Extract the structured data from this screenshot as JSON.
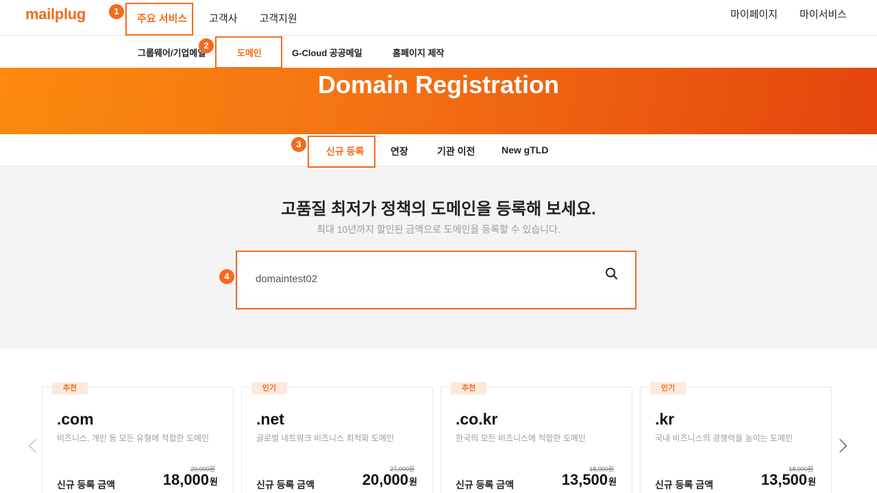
{
  "header": {
    "logo": "mailplug",
    "menu": [
      "주요 서비스",
      "고객사",
      "고객지원"
    ],
    "right_menu": [
      "마이페이지",
      "마이서비스"
    ]
  },
  "subnav": {
    "items": [
      "그룹웨어/기업메일",
      "도메인",
      "G-Cloud 공공메일",
      "홈페이지 제작"
    ]
  },
  "hero": {
    "title": "Domain Registration"
  },
  "tabs": [
    "신규 등록",
    "연장",
    "기관 이전",
    "New gTLD"
  ],
  "search": {
    "headline": "고품질 최저가 정책의 도메인을 등록해 보세요.",
    "subline": "최대 10년까지 할인된 금액으로 도메인을 등록할 수 있습니다.",
    "value": "domaintest02"
  },
  "cards": [
    {
      "badge": "추천",
      "tld": ".com",
      "desc": "비즈니스, 개인 등 모든 유형에 적합한 도메인",
      "old_price": "20,000원",
      "label": "신규 등록 금액",
      "price": "18,000",
      "unit": "원"
    },
    {
      "badge": "인기",
      "tld": ".net",
      "desc": "글로벌 네트워크 비즈니스 최적화 도메인",
      "old_price": "27,000원",
      "label": "신규 등록 금액",
      "price": "20,000",
      "unit": "원"
    },
    {
      "badge": "추천",
      "tld": ".co.kr",
      "desc": "한국의 모든 비즈니스에 적합한 도메인",
      "old_price": "18,000원",
      "label": "신규 등록 금액",
      "price": "13,500",
      "unit": "원"
    },
    {
      "badge": "인기",
      "tld": ".kr",
      "desc": "국내 비즈니스의 경쟁력을 높이는 도메인",
      "old_price": "18,000원",
      "label": "신규 등록 금액",
      "price": "13,500",
      "unit": "원"
    }
  ],
  "annotations": [
    "1",
    "2",
    "3",
    "4"
  ],
  "colors": {
    "accent": "#f26b1d",
    "hero_start": "#fb8a0e",
    "hero_end": "#e4450c"
  }
}
